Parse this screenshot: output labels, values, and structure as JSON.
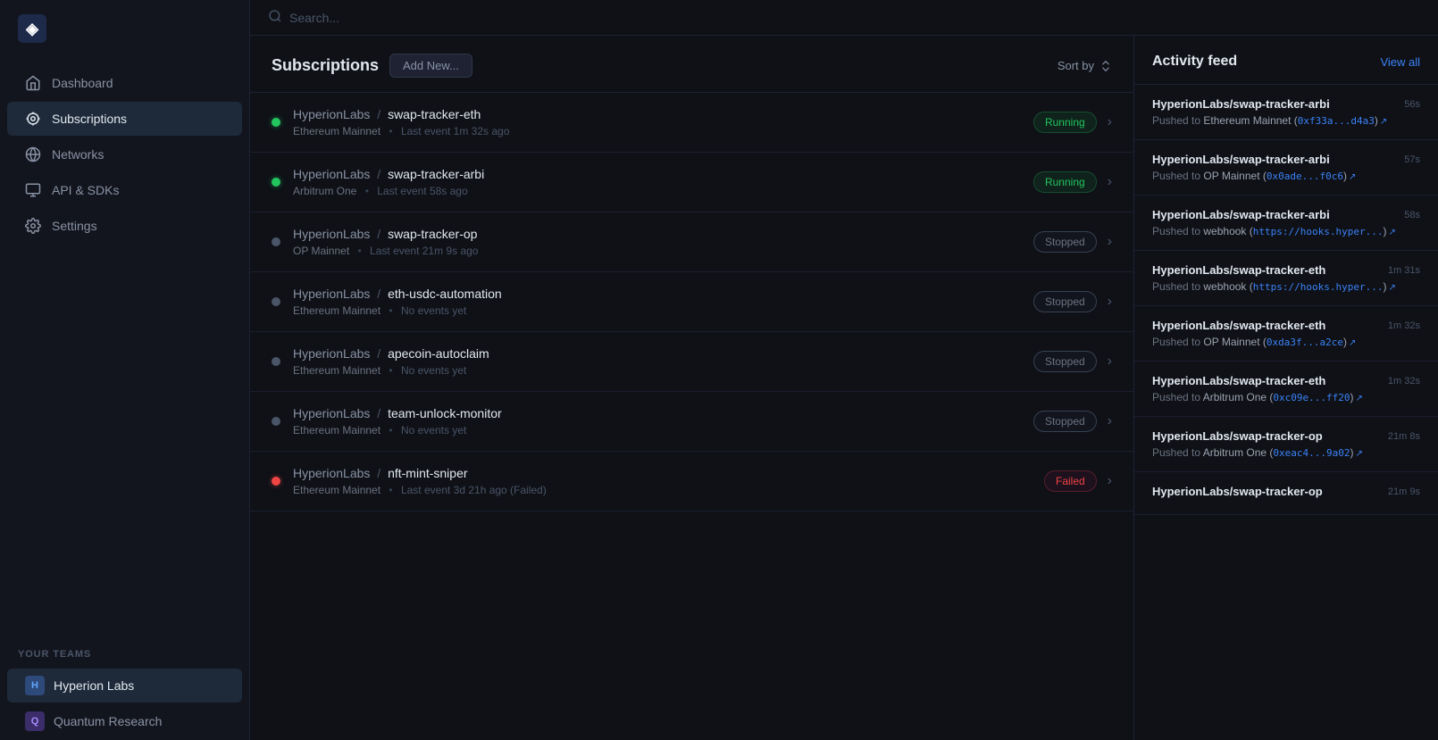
{
  "app": {
    "logo_text": "◈"
  },
  "sidebar": {
    "nav_items": [
      {
        "id": "dashboard",
        "label": "Dashboard",
        "icon": "home",
        "active": false
      },
      {
        "id": "subscriptions",
        "label": "Subscriptions",
        "icon": "subscriptions",
        "active": true
      },
      {
        "id": "networks",
        "label": "Networks",
        "icon": "networks",
        "active": false
      },
      {
        "id": "api-sdks",
        "label": "API & SDKs",
        "icon": "api",
        "active": false
      },
      {
        "id": "settings",
        "label": "Settings",
        "icon": "settings",
        "active": false
      }
    ],
    "teams_label": "Your teams",
    "teams": [
      {
        "id": "hyperion",
        "initial": "H",
        "name": "Hyperion Labs",
        "avatar_class": "h",
        "active": true
      },
      {
        "id": "quantum",
        "initial": "Q",
        "name": "Quantum Research",
        "avatar_class": "q",
        "active": false
      }
    ]
  },
  "search": {
    "placeholder": "Search..."
  },
  "subscriptions": {
    "title": "Subscriptions",
    "add_button": "Add New...",
    "sort_label": "Sort by",
    "items": [
      {
        "id": "swap-tracker-eth",
        "org": "HyperionLabs",
        "slash": "/",
        "repo": "swap-tracker-eth",
        "network": "Ethereum Mainnet",
        "meta": "Last event 1m 32s ago",
        "status": "running",
        "badge_label": "Running"
      },
      {
        "id": "swap-tracker-arbi",
        "org": "HyperionLabs",
        "slash": "/",
        "repo": "swap-tracker-arbi",
        "network": "Arbitrum One",
        "meta": "Last event 58s ago",
        "status": "running",
        "badge_label": "Running"
      },
      {
        "id": "swap-tracker-op",
        "org": "HyperionLabs",
        "slash": "/",
        "repo": "swap-tracker-op",
        "network": "OP Mainnet",
        "meta": "Last event 21m 9s ago",
        "status": "stopped",
        "badge_label": "Stopped"
      },
      {
        "id": "eth-usdc-automation",
        "org": "HyperionLabs",
        "slash": "/",
        "repo": "eth-usdc-automation",
        "network": "Ethereum Mainnet",
        "meta": "No events yet",
        "status": "stopped",
        "badge_label": "Stopped"
      },
      {
        "id": "apecoin-autoclaim",
        "org": "HyperionLabs",
        "slash": "/",
        "repo": "apecoin-autoclaim",
        "network": "Ethereum Mainnet",
        "meta": "No events yet",
        "status": "stopped",
        "badge_label": "Stopped"
      },
      {
        "id": "team-unlock-monitor",
        "org": "HyperionLabs",
        "slash": "/",
        "repo": "team-unlock-monitor",
        "network": "Ethereum Mainnet",
        "meta": "No events yet",
        "status": "stopped",
        "badge_label": "Stopped"
      },
      {
        "id": "nft-mint-sniper",
        "org": "HyperionLabs",
        "slash": "/",
        "repo": "nft-mint-sniper",
        "network": "Ethereum Mainnet",
        "meta": "Last event 3d 21h ago (Failed)",
        "status": "failed",
        "badge_label": "Failed"
      }
    ]
  },
  "activity_feed": {
    "title": "Activity feed",
    "view_all_label": "View all",
    "items": [
      {
        "id": "af1",
        "name": "HyperionLabs/swap-tracker-arbi",
        "time": "56s",
        "desc_prefix": "Pushed to",
        "network": "Ethereum Mainnet",
        "addr": "0xf33a...d4a3",
        "addr_type": "address"
      },
      {
        "id": "af2",
        "name": "HyperionLabs/swap-tracker-arbi",
        "time": "57s",
        "desc_prefix": "Pushed to",
        "network": "OP Mainnet",
        "addr": "0x0ade...f0c6",
        "addr_type": "address"
      },
      {
        "id": "af3",
        "name": "HyperionLabs/swap-tracker-arbi",
        "time": "58s",
        "desc_prefix": "Pushed to",
        "network": "webhook",
        "addr": "https://hooks.hyper...",
        "addr_type": "webhook"
      },
      {
        "id": "af4",
        "name": "HyperionLabs/swap-tracker-eth",
        "time": "1m 31s",
        "desc_prefix": "Pushed to",
        "network": "webhook",
        "addr": "https://hooks.hyper...",
        "addr_type": "webhook"
      },
      {
        "id": "af5",
        "name": "HyperionLabs/swap-tracker-eth",
        "time": "1m 32s",
        "desc_prefix": "Pushed to",
        "network": "OP Mainnet",
        "addr": "0xda3f...a2ce",
        "addr_type": "address"
      },
      {
        "id": "af6",
        "name": "HyperionLabs/swap-tracker-eth",
        "time": "1m 32s",
        "desc_prefix": "Pushed to",
        "network": "Arbitrum One",
        "addr": "0xc09e...ff20",
        "addr_type": "address"
      },
      {
        "id": "af7",
        "name": "HyperionLabs/swap-tracker-op",
        "time": "21m 8s",
        "desc_prefix": "Pushed to",
        "network": "Arbitrum One",
        "addr": "0xeac4...9a02",
        "addr_type": "address"
      },
      {
        "id": "af8",
        "name": "HyperionLabs/swap-tracker-op",
        "time": "21m 9s",
        "desc_prefix": "Pushed to",
        "network": "",
        "addr": "",
        "addr_type": ""
      }
    ]
  }
}
